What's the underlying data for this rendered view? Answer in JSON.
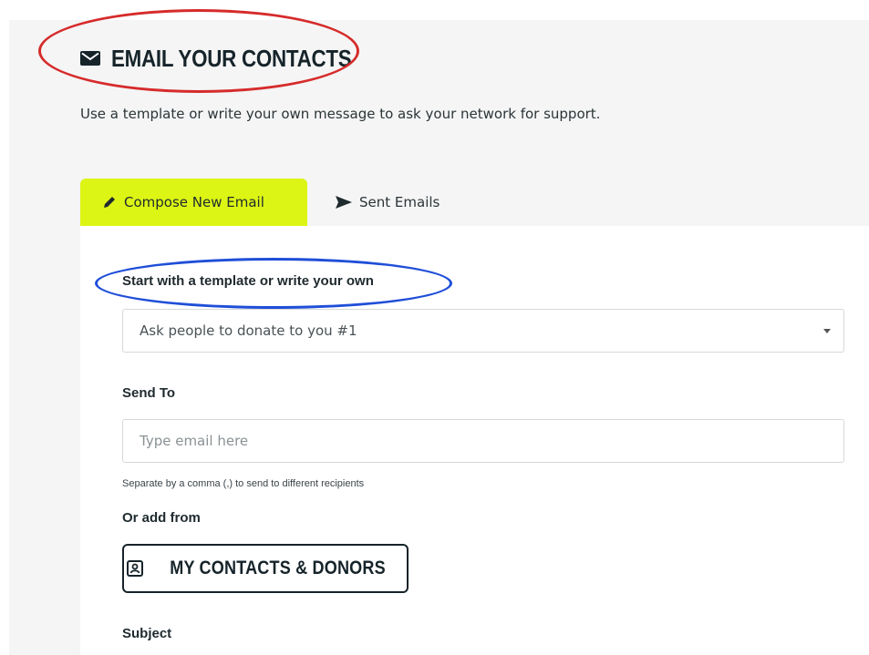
{
  "header": {
    "title": "EMAIL YOUR CONTACTS",
    "subtitle": "Use a template or write your own message to ask your network for support."
  },
  "tabs": [
    {
      "label": "Compose New Email",
      "active": true,
      "icon": "pencil-icon"
    },
    {
      "label": "Sent Emails",
      "active": false,
      "icon": "send-icon"
    }
  ],
  "form": {
    "template": {
      "label": "Start with a template or write your own",
      "selected": "Ask people to donate to you #1"
    },
    "send_to": {
      "label": "Send To",
      "placeholder": "Type email here",
      "value": "",
      "hint": "Separate by a comma (,) to send to different recipients"
    },
    "add_from": {
      "label": "Or add from",
      "button_label": "MY CONTACTS & DONORS",
      "icon": "contact-card-icon"
    },
    "subject": {
      "label": "Subject"
    }
  },
  "colors": {
    "active_tab": "#dcf514",
    "annotation_red": "#d62b2b",
    "annotation_blue": "#1f4ed8",
    "text_dark": "#16242a"
  }
}
